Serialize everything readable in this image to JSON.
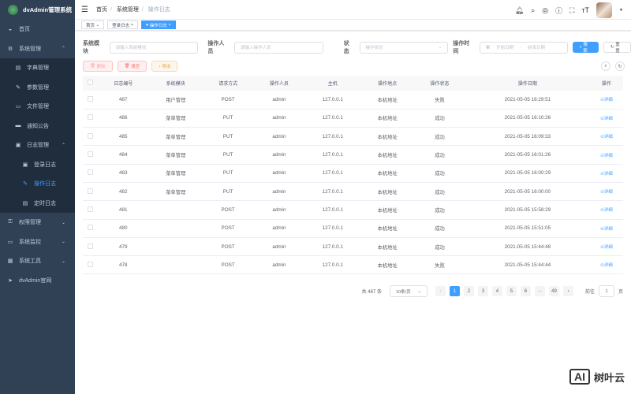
{
  "app": {
    "title": "dvAdmin管理系统"
  },
  "sidebar": {
    "items": [
      {
        "label": "首页",
        "icon": "dashboard-icon"
      },
      {
        "label": "系统管理",
        "icon": "gear-icon"
      },
      {
        "label": "字典管理",
        "icon": "dict-icon"
      },
      {
        "label": "参数管理",
        "icon": "edit-icon"
      },
      {
        "label": "文件管理",
        "icon": "file-icon"
      },
      {
        "label": "通知公告",
        "icon": "message-icon"
      },
      {
        "label": "日志管理",
        "icon": "log-icon"
      },
      {
        "label": "登录日志",
        "icon": "login-log-icon"
      },
      {
        "label": "操作日志",
        "icon": "operation-log-icon"
      },
      {
        "label": "定时日志",
        "icon": "timer-log-icon"
      },
      {
        "label": "权限管理",
        "icon": "lock-icon"
      },
      {
        "label": "系统监控",
        "icon": "monitor-icon"
      },
      {
        "label": "系统工具",
        "icon": "tool-icon"
      },
      {
        "label": "dvAdmin官网",
        "icon": "send-icon"
      }
    ]
  },
  "breadcrumb": [
    "首页",
    "系统管理",
    "操作日志"
  ],
  "tags": [
    "首页",
    "登录日志",
    "操作日志"
  ],
  "filters": {
    "module_label": "系统模块",
    "module_placeholder": "请输入系统模块",
    "user_label": "操作人员",
    "user_placeholder": "请输入操作人员",
    "status_label": "状态",
    "status_placeholder": "操作状态",
    "time_label": "操作时间",
    "start_placeholder": "开始日期",
    "end_placeholder": "结束日期",
    "search": "搜索",
    "reset": "重置"
  },
  "toolbar": {
    "delete": "删除",
    "clear": "清空",
    "export": "导出"
  },
  "table": {
    "headers": [
      "日志编号",
      "系统模块",
      "请求方式",
      "操作人员",
      "主机",
      "操作地点",
      "操作状态",
      "操作日期",
      "操作"
    ],
    "detail_label": "详细",
    "rows": [
      [
        "487",
        "用户管理",
        "POST",
        "admin",
        "127.0.0.1",
        "本机地址",
        "失败",
        "2021-05-05 16:29:51"
      ],
      [
        "486",
        "菜单管理",
        "PUT",
        "admin",
        "127.0.0.1",
        "本机地址",
        "成功",
        "2021-05-05 16:10:26"
      ],
      [
        "485",
        "菜单管理",
        "PUT",
        "admin",
        "127.0.0.1",
        "本机地址",
        "成功",
        "2021-05-05 16:09:33"
      ],
      [
        "484",
        "菜单管理",
        "PUT",
        "admin",
        "127.0.0.1",
        "本机地址",
        "成功",
        "2021-05-05 16:01:26"
      ],
      [
        "483",
        "菜单管理",
        "PUT",
        "admin",
        "127.0.0.1",
        "本机地址",
        "成功",
        "2021-05-05 16:00:29"
      ],
      [
        "482",
        "菜单管理",
        "PUT",
        "admin",
        "127.0.0.1",
        "本机地址",
        "成功",
        "2021-05-05 16:00:00"
      ],
      [
        "481",
        "",
        "POST",
        "admin",
        "127.0.0.1",
        "本机地址",
        "成功",
        "2021-05-05 15:58:29"
      ],
      [
        "480",
        "",
        "POST",
        "admin",
        "127.0.0.1",
        "本机地址",
        "成功",
        "2021-05-05 15:51:05"
      ],
      [
        "479",
        "",
        "POST",
        "admin",
        "127.0.0.1",
        "本机地址",
        "成功",
        "2021-05-05 15:44:48"
      ],
      [
        "478",
        "",
        "POST",
        "admin",
        "127.0.0.1",
        "本机地址",
        "失败",
        "2021-05-05 15:44:44"
      ]
    ]
  },
  "pagination": {
    "total": "共 487 条",
    "page_size": "10条/页",
    "pages": [
      "1",
      "2",
      "3",
      "4",
      "5",
      "6",
      "···",
      "49"
    ],
    "current": "1",
    "goto_label": "前往",
    "goto_value": "1",
    "goto_suffix": "页"
  },
  "watermark": {
    "logo": "AI",
    "text": "树叶云"
  }
}
